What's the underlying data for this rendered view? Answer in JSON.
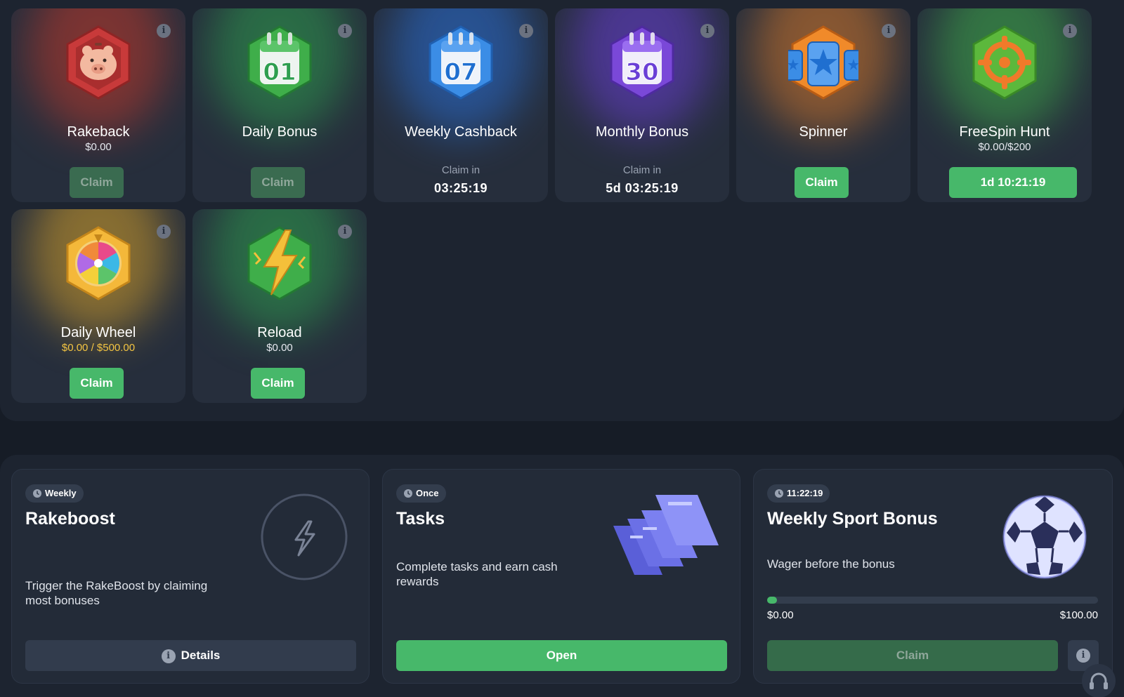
{
  "rewards": [
    {
      "title": "Rakeback",
      "sub": "$0.00",
      "button": "Claim",
      "button_state": "disabled",
      "icon": "piggy-bank-icon",
      "glow": "#c0392b"
    },
    {
      "title": "Daily Bonus",
      "sub": "",
      "button": "Claim",
      "button_state": "disabled",
      "icon": "calendar-01-icon",
      "calendar_number": "01",
      "glow": "#2e9e4f"
    },
    {
      "title": "Weekly Cashback",
      "claim_in_label": "Claim in",
      "timer": "03:25:19",
      "icon": "calendar-07-icon",
      "calendar_number": "07",
      "glow": "#2a6fd6"
    },
    {
      "title": "Monthly Bonus",
      "claim_in_label": "Claim in",
      "timer": "5d 03:25:19",
      "icon": "calendar-30-icon",
      "calendar_number": "30",
      "glow": "#6a3fd6"
    },
    {
      "title": "Spinner",
      "sub": "",
      "button": "Claim",
      "button_state": "enabled",
      "icon": "slot-stars-icon",
      "glow": "#d6782a"
    },
    {
      "title": "FreeSpin Hunt",
      "sub": "$0.00/$200",
      "button": "1d 10:21:19",
      "button_state": "enabled",
      "icon": "crosshair-target-icon",
      "glow": "#3fae4a"
    },
    {
      "title": "Daily Wheel",
      "sub": "$0.00 / $500.00",
      "sub_color": "gold",
      "button": "Claim",
      "button_state": "enabled",
      "icon": "prize-wheel-icon",
      "glow": "#d6a12a"
    },
    {
      "title": "Reload",
      "sub": "$0.00",
      "button": "Claim",
      "button_state": "enabled",
      "icon": "lightning-bolt-icon",
      "glow": "#2e9e4f"
    }
  ],
  "bonuses": {
    "rakeboost": {
      "pill": "Weekly",
      "title": "Rakeboost",
      "desc": "Trigger the RakeBoost by claiming most bonuses",
      "button": "Details"
    },
    "tasks": {
      "pill": "Once",
      "title": "Tasks",
      "desc": "Complete tasks and earn cash rewards",
      "button": "Open"
    },
    "sport": {
      "pill": "11:22:19",
      "title": "Weekly Sport Bonus",
      "desc": "Wager before the bonus",
      "progress_min": "$0.00",
      "progress_max": "$100.00",
      "progress_fraction": 0.0,
      "button": "Claim"
    }
  },
  "colors": {
    "accent_green": "#47b86a",
    "gold": "#f4c542",
    "panel": "#1d2430",
    "card": "#262e3c"
  }
}
